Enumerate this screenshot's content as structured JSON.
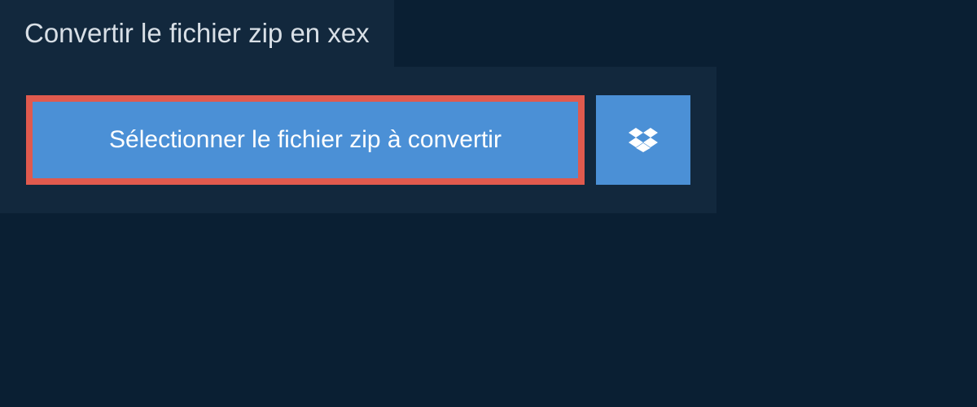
{
  "header": {
    "title": "Convertir le fichier zip en xex"
  },
  "actions": {
    "select_file_label": "Sélectionner le fichier zip à convertir",
    "dropbox_icon": "dropbox"
  },
  "colors": {
    "background_dark": "#0a1f33",
    "panel": "#12283d",
    "button_blue": "#4b90d6",
    "button_highlight_border": "#e05a4e",
    "text_light": "#d8dfe6"
  }
}
